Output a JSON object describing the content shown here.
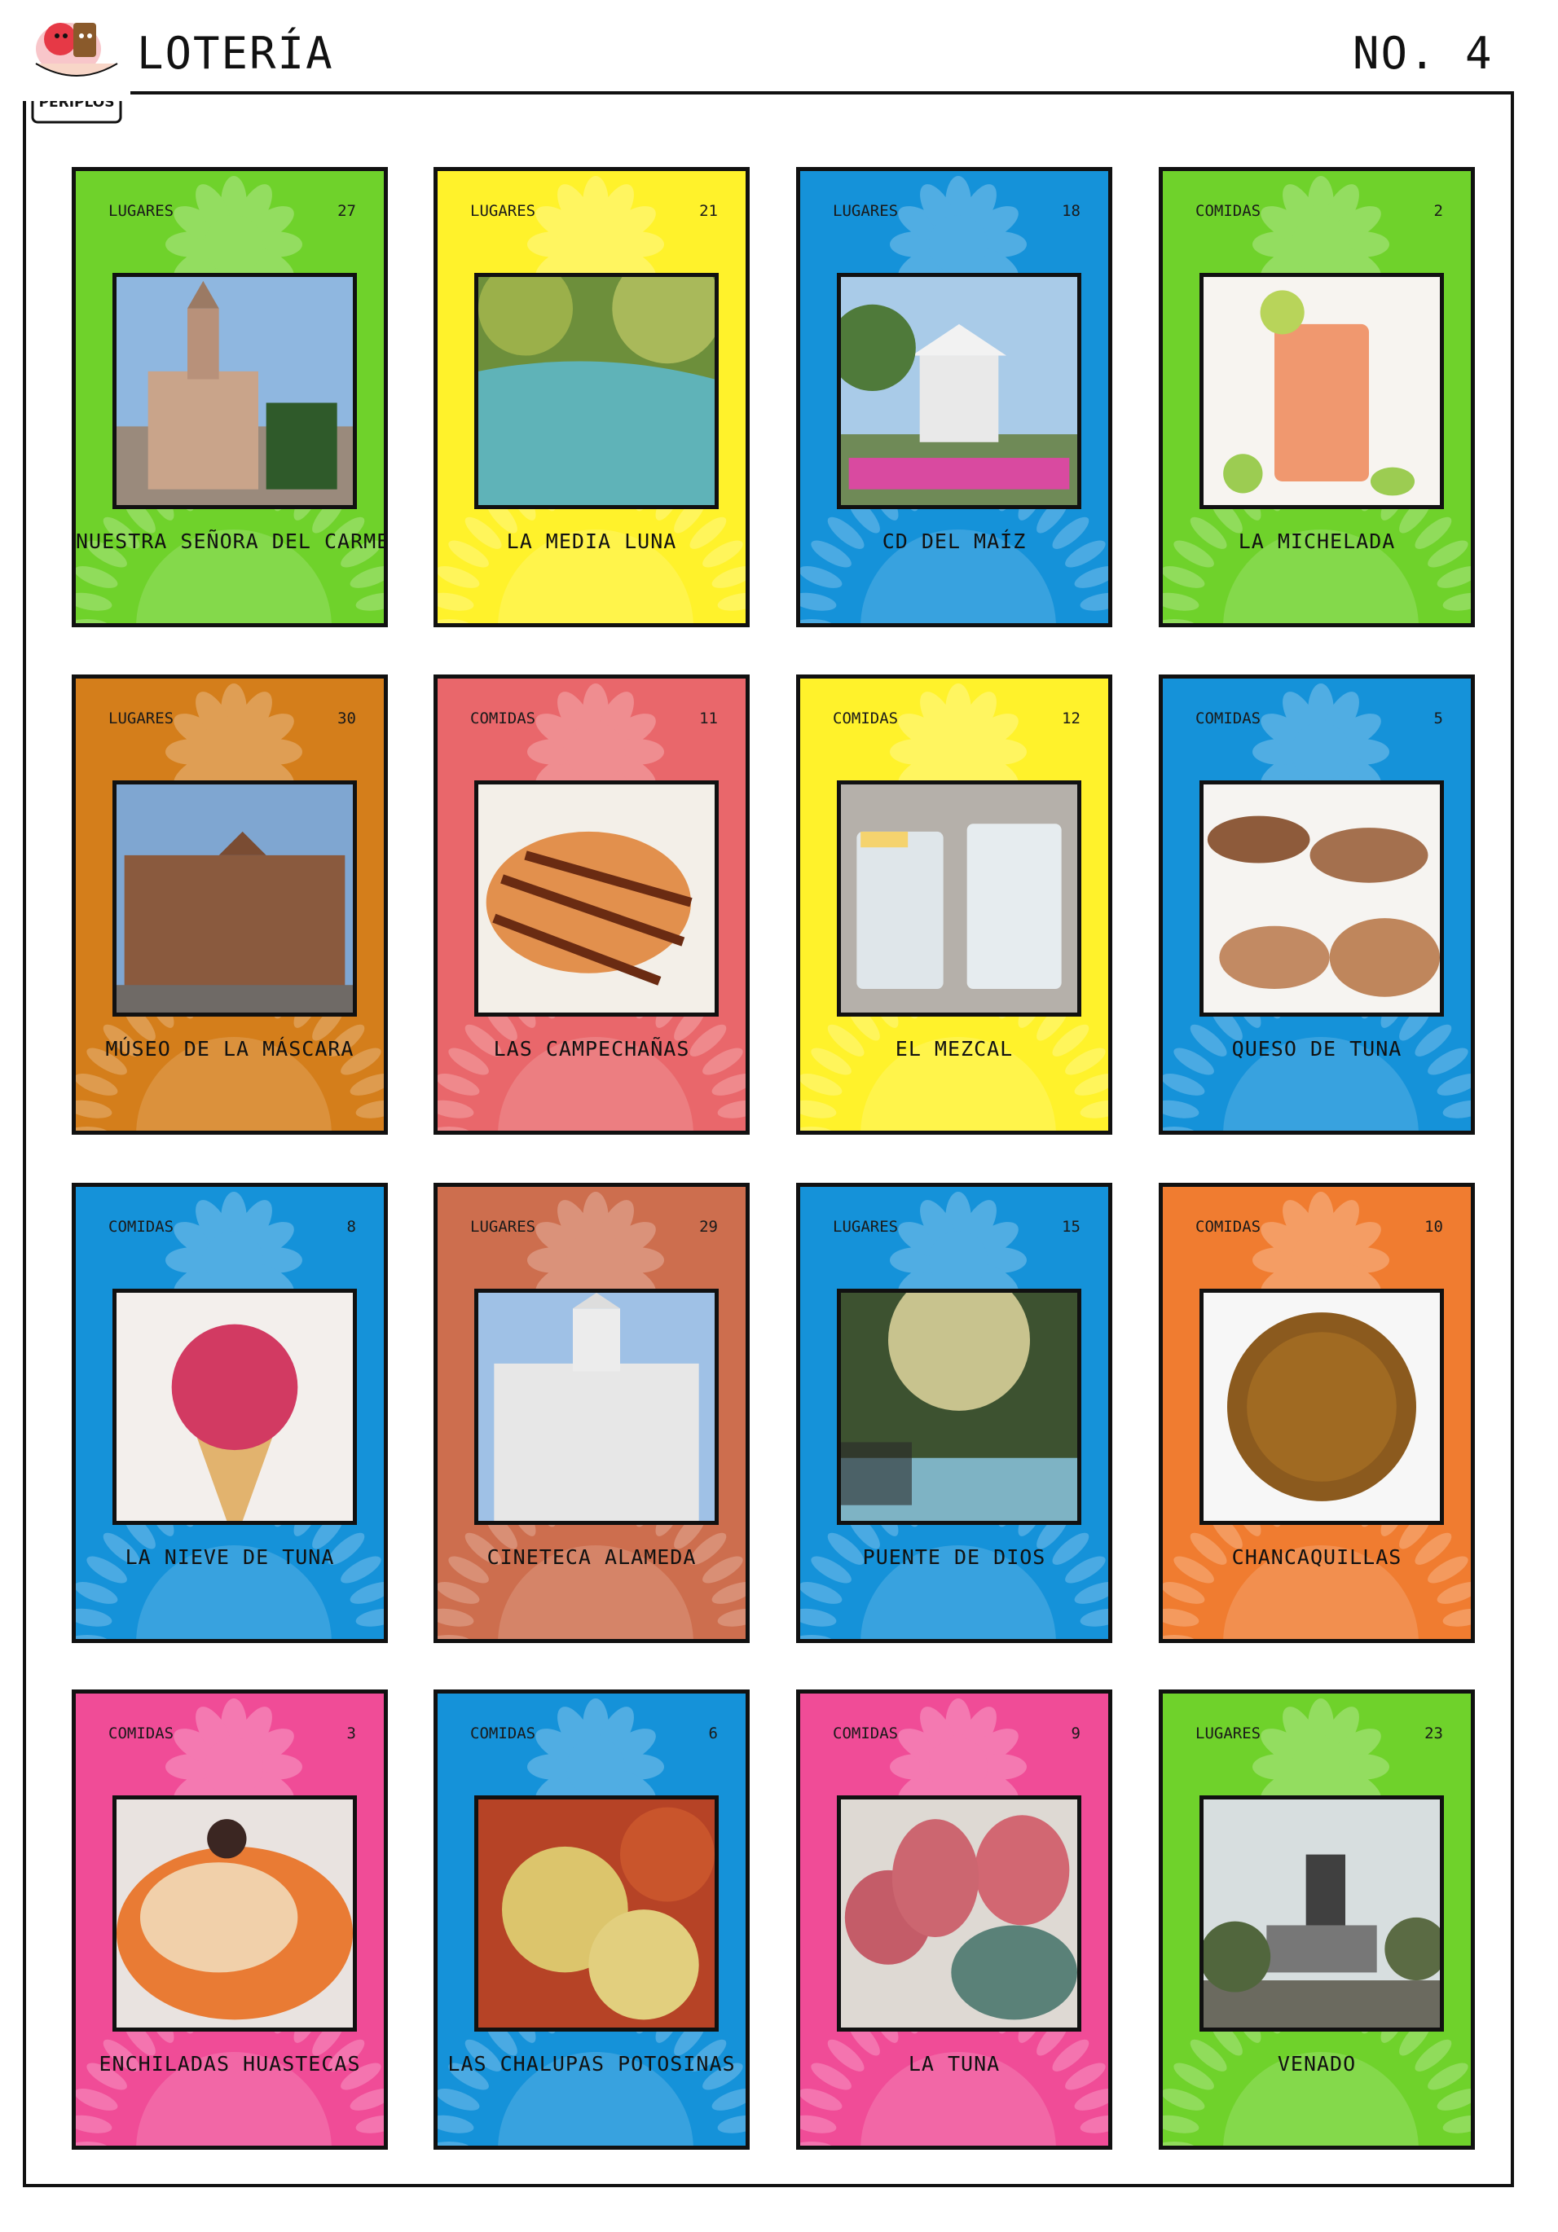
{
  "header": {
    "logo_text": "PERIPLOS",
    "title": "LOTERÍA",
    "number": "NO. 4"
  },
  "colors": {
    "green": "#6fd22b",
    "yellow": "#fff22b",
    "blue": "#1592d9",
    "orange_brown": "#d47e1b",
    "salmon": "#e9676b",
    "clay": "#cd6e4e",
    "orange": "#f07c30",
    "pink": "#f04c97"
  },
  "cards": [
    {
      "category": "LUGARES",
      "number": "27",
      "name": "NUESTRA SEÑORA DEL CARMEN",
      "image": "church-image",
      "color": "#6fd22b"
    },
    {
      "category": "LUGARES",
      "number": "21",
      "name": "LA MEDIA LUNA",
      "image": "river-image",
      "color": "#fff22b"
    },
    {
      "category": "LUGARES",
      "number": "18",
      "name": "CD DEL MAÍZ",
      "image": "kiosk-image",
      "color": "#1592d9"
    },
    {
      "category": "COMIDAS",
      "number": "2",
      "name": "LA MICHELADA",
      "image": "michelada-image",
      "color": "#6fd22b"
    },
    {
      "category": "LUGARES",
      "number": "30",
      "name": "MÚSEO DE LA MÁSCARA",
      "image": "museum-image",
      "color": "#d47e1b"
    },
    {
      "category": "COMIDAS",
      "number": "11",
      "name": "LAS CAMPECHAÑAS",
      "image": "pastry-image",
      "color": "#e9676b"
    },
    {
      "category": "COMIDAS",
      "number": "12",
      "name": "EL MEZCAL",
      "image": "mezcal-image",
      "color": "#fff22b"
    },
    {
      "category": "COMIDAS",
      "number": "5",
      "name": "QUESO DE TUNA",
      "image": "queso-image",
      "color": "#1592d9"
    },
    {
      "category": "COMIDAS",
      "number": "8",
      "name": "LA NIEVE DE TUNA",
      "image": "icecream-image",
      "color": "#1592d9"
    },
    {
      "category": "LUGARES",
      "number": "29",
      "name": "CINETECA ALAMEDA",
      "image": "cineteca-image",
      "color": "#cd6e4e"
    },
    {
      "category": "LUGARES",
      "number": "15",
      "name": "PUENTE DE DIOS",
      "image": "cave-image",
      "color": "#1592d9"
    },
    {
      "category": "COMIDAS",
      "number": "10",
      "name": "CHANCAQUILLAS",
      "image": "chancaquilla-image",
      "color": "#f07c30"
    },
    {
      "category": "COMIDAS",
      "number": "3",
      "name": "ENCHILADAS HUASTECAS",
      "image": "enchiladas-image",
      "color": "#f04c97"
    },
    {
      "category": "COMIDAS",
      "number": "6",
      "name": "LAS CHALUPAS POTOSINAS",
      "image": "chalupas-image",
      "color": "#1592d9"
    },
    {
      "category": "COMIDAS",
      "number": "9",
      "name": "LA TUNA",
      "image": "tuna-image",
      "color": "#f04c97"
    },
    {
      "category": "LUGARES",
      "number": "23",
      "name": "VENADO",
      "image": "deer-statue-image",
      "color": "#6fd22b"
    }
  ]
}
